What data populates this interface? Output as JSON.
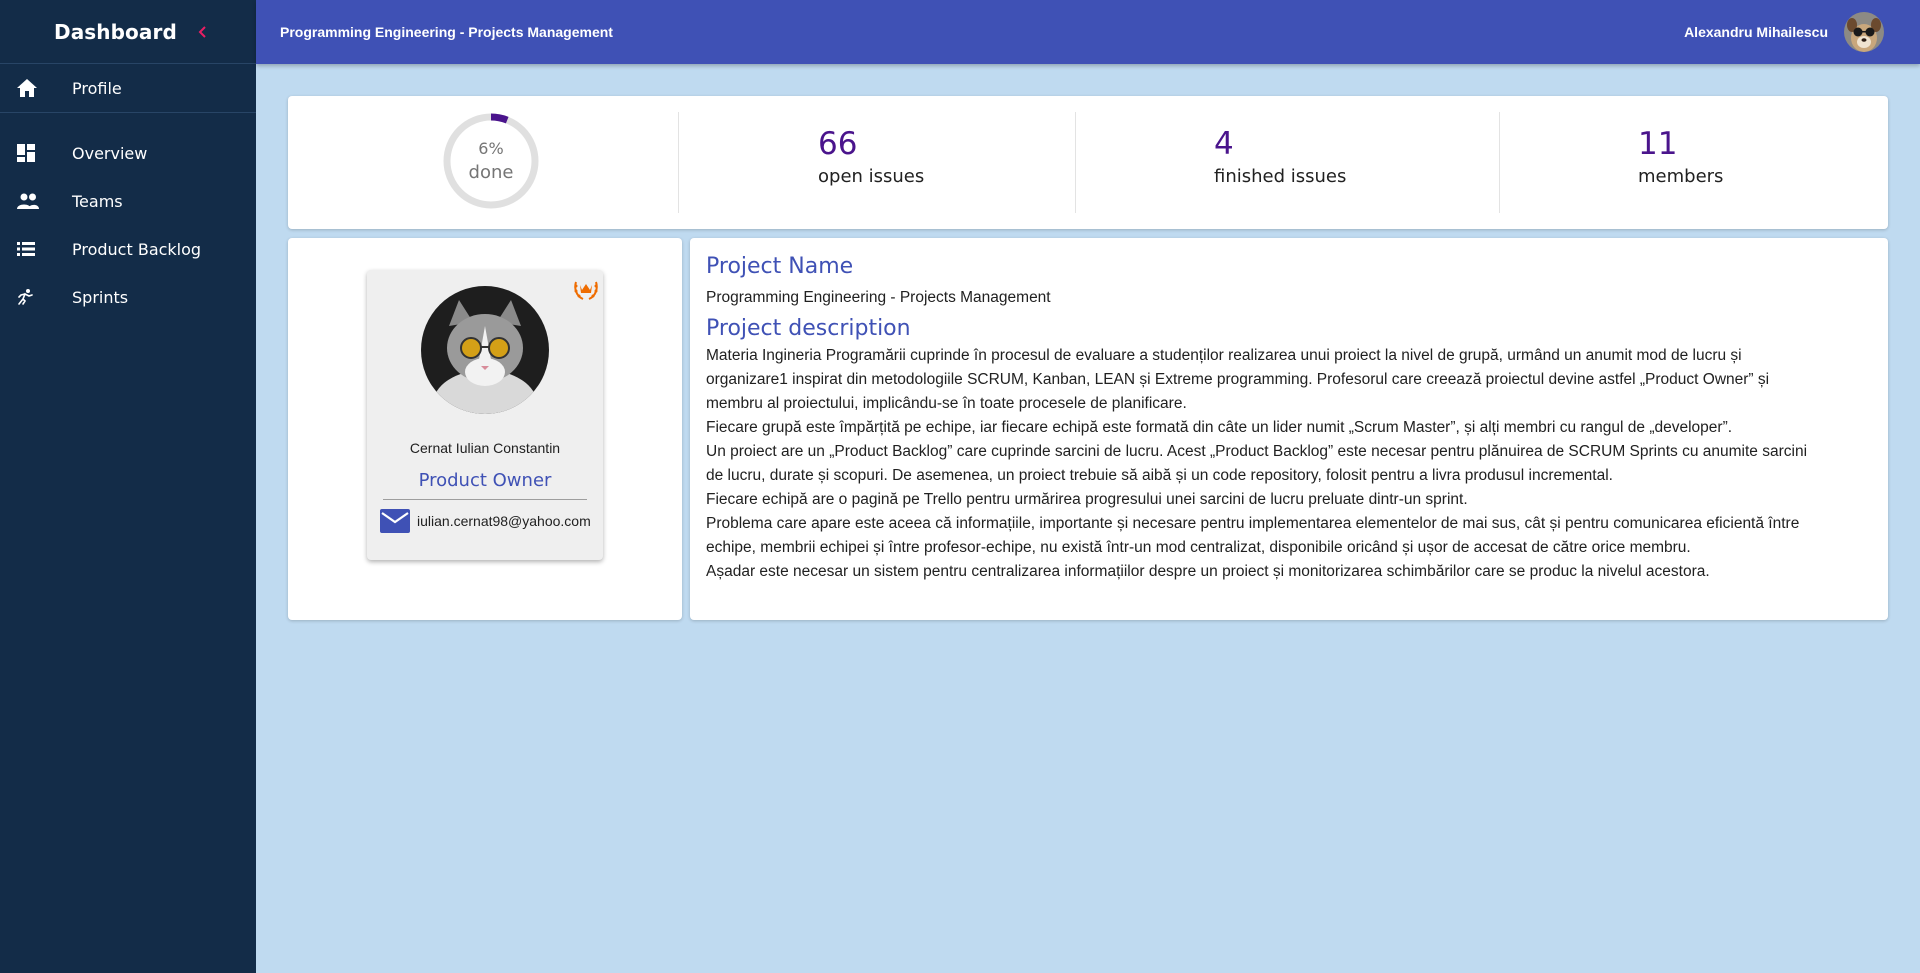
{
  "sidebar": {
    "title": "Dashboard",
    "collapse_icon": "chevron-left-icon",
    "accent_color": "#e91e63",
    "items": [
      {
        "label": "Profile",
        "icon": "home-icon"
      },
      {
        "label": "Overview",
        "icon": "dashboard-icon"
      },
      {
        "label": "Teams",
        "icon": "people-icon"
      },
      {
        "label": "Product Backlog",
        "icon": "list-icon"
      },
      {
        "label": "Sprints",
        "icon": "sprint-icon"
      }
    ]
  },
  "appbar": {
    "title": "Programming Engineering - Projects Management",
    "user_name": "Alexandru Mihailescu",
    "color": "#3f51b5"
  },
  "stats": {
    "progress_percent": 6,
    "progress_text": "6%",
    "progress_label": "done",
    "open_issues": {
      "value": "66",
      "label": "open issues"
    },
    "finished_issues": {
      "value": "4",
      "label": "finished issues"
    },
    "members": {
      "value": "11",
      "label": "members"
    }
  },
  "owner": {
    "name": "Cernat Iulian Constantin",
    "role": "Product Owner",
    "email": "iulian.cernat98@yahoo.com",
    "badge_icon": "crown-laurel-icon"
  },
  "project": {
    "name_heading": "Project Name",
    "name": "Programming Engineering - Projects Management",
    "description_heading": "Project description",
    "description_lines": [
      "Materia Ingineria Programării cuprinde în procesul de evaluare a studenților realizarea unui proiect la nivel de grupă, urmând un anumit mod de lucru și",
      "organizare1 inspirat din metodologiile SCRUM, Kanban, LEAN și Extreme programming. Profesorul care creează proiectul devine  astfel „Product Owner” și",
      "membru al proiectului, implicându-se în toate procesele de planificare.",
      "Fiecare grupă este împărțită pe echipe, iar fiecare echipă este formată din câte un lider numit „Scrum Master”, și alți membri cu rangul de „developer”.",
      "Un proiect are un „Product Backlog” care cuprinde sarcini de lucru. Acest „Product Backlog” este necesar pentru plănuirea de SCRUM Sprints cu anumite sarcini",
      "de lucru, durate și scopuri. De asemenea, un proiect trebuie să aibă și un code repository, folosit pentru a livra produsul incremental.",
      "Fiecare echipă are o pagină pe Trello pentru urmărirea progresului unei sarcini de lucru preluate dintr-un sprint.",
      "Problema care apare este aceea că informațiile, importante și necesare pentru implementarea elementelor de mai sus, cât și pentru comunicarea eficientă între",
      "echipe, membrii echipei și între profesor-echipe, nu există într-un mod centralizat, disponibile oricând și ușor de accesat de către orice membru.",
      "Așadar este necesar un sistem pentru centralizarea informațiilor despre un proiect și monitorizarea schimbărilor care se produc la nivelul acestora."
    ]
  }
}
